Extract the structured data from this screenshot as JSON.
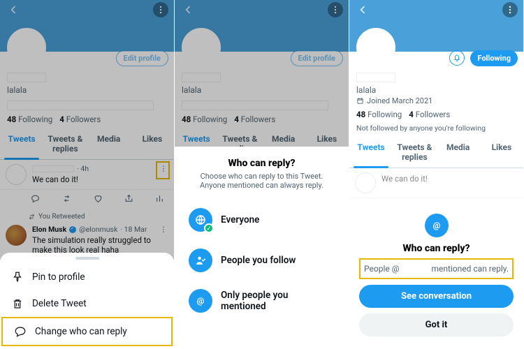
{
  "colors": {
    "accent": "#1d9bf0",
    "highlight": "#e6b800",
    "success": "#00ba7c"
  },
  "profile_buttons": {
    "edit": "Edit profile",
    "following": "Following"
  },
  "handle": "lalala",
  "joined": "Joined March 2021",
  "stats": {
    "following_count": "48",
    "following_label": "Following",
    "followers_count": "4",
    "followers_label": "Followers"
  },
  "not_followed_text": "Not followed by anyone you're following",
  "tabs": [
    "Tweets",
    "Tweets & replies",
    "Media",
    "Likes"
  ],
  "tweet1": {
    "time": "· 4h",
    "text": "We can do it!"
  },
  "retweet_label": "You Retweeted",
  "tweet2": {
    "name": "Elon Musk",
    "handle": "@elonmusk",
    "time": "· 18 Mar",
    "text": "The simulation really struggled to make this look real haha"
  },
  "sheet1": {
    "pin": "Pin to profile",
    "delete": "Delete Tweet",
    "change": "Change who can reply"
  },
  "sheet2": {
    "title": "Who can reply?",
    "subtitle": "Choose who can reply to this Tweet. Anyone mentioned can always reply.",
    "everyone": "Everyone",
    "follow": "People you follow",
    "mentioned": "Only people you mentioned"
  },
  "dialog3": {
    "title": "Who can reply?",
    "msg_prefix": "People @",
    "msg_suffix": "mentioned can reply.",
    "see": "See conversation",
    "gotit": "Got it"
  }
}
